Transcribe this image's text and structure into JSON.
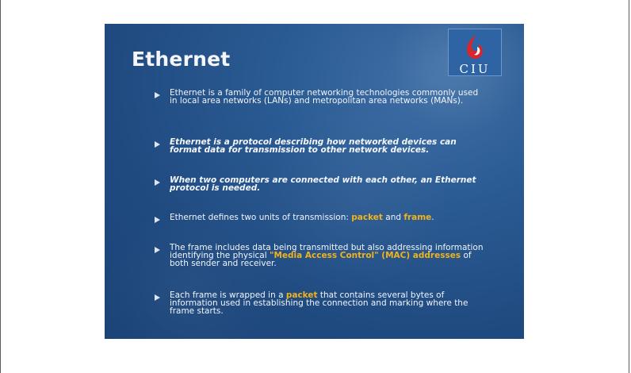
{
  "slide": {
    "title": "Ethernet",
    "logo_text": "CIU",
    "bullets": [
      {
        "text": "Ethernet is a family of computer networking technologies commonly used in local area networks (LANs) and metropolitan area networks (MANs)."
      },
      {
        "text": "Ethernet is a protocol describing how networked devices can format data for transmission to other network devices."
      },
      {
        "text": "When two computers are connected with each other, an Ethernet protocol is needed."
      },
      {
        "pre": "Ethernet defines two units of transmission: ",
        "hl1": "packet",
        "mid": " and ",
        "hl2": "frame",
        "post": "."
      },
      {
        "pre": "The frame includes data being transmitted but also addressing information identifying the physical ",
        "hl1": "\"Media Access Control\" (MAC) addresses",
        "post": " of both sender and receiver."
      },
      {
        "pre": "Each frame is wrapped in a ",
        "hl1": "packet",
        "post": " that contains several bytes of information used in establishing the connection and marking where the frame starts."
      }
    ]
  },
  "colors": {
    "slide_background": "#1f4a80",
    "highlight": "#f3b21a",
    "text": "#f2f5fa"
  }
}
